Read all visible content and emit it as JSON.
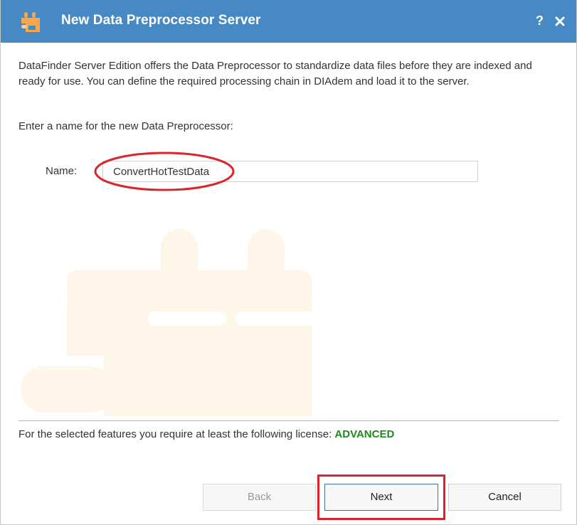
{
  "window": {
    "title": "New Data Preprocessor Server",
    "help_label": "?",
    "icons": {
      "app": "preprocessor-plug-icon",
      "close": "close-icon",
      "watermark": "preprocessor-plug-watermark-icon"
    },
    "colors": {
      "titlebar": "#4689c4",
      "license_level": "#1e8a1e",
      "annotation": "#d8262c",
      "watermark": "#fff6ea"
    }
  },
  "content": {
    "description": "DataFinder Server Edition offers the Data Preprocessor to standardize data files before they are indexed and ready for use. You can define the required processing chain in DIAdem and load it to the server.",
    "prompt": "Enter a name for the new Data Preprocessor:",
    "name_label": "Name:",
    "name_value": "ConvertHotTestData"
  },
  "license": {
    "text": "For the selected features you require at least the following license:",
    "level": "ADVANCED"
  },
  "buttons": {
    "back": "Back",
    "next": "Next",
    "cancel": "Cancel"
  }
}
